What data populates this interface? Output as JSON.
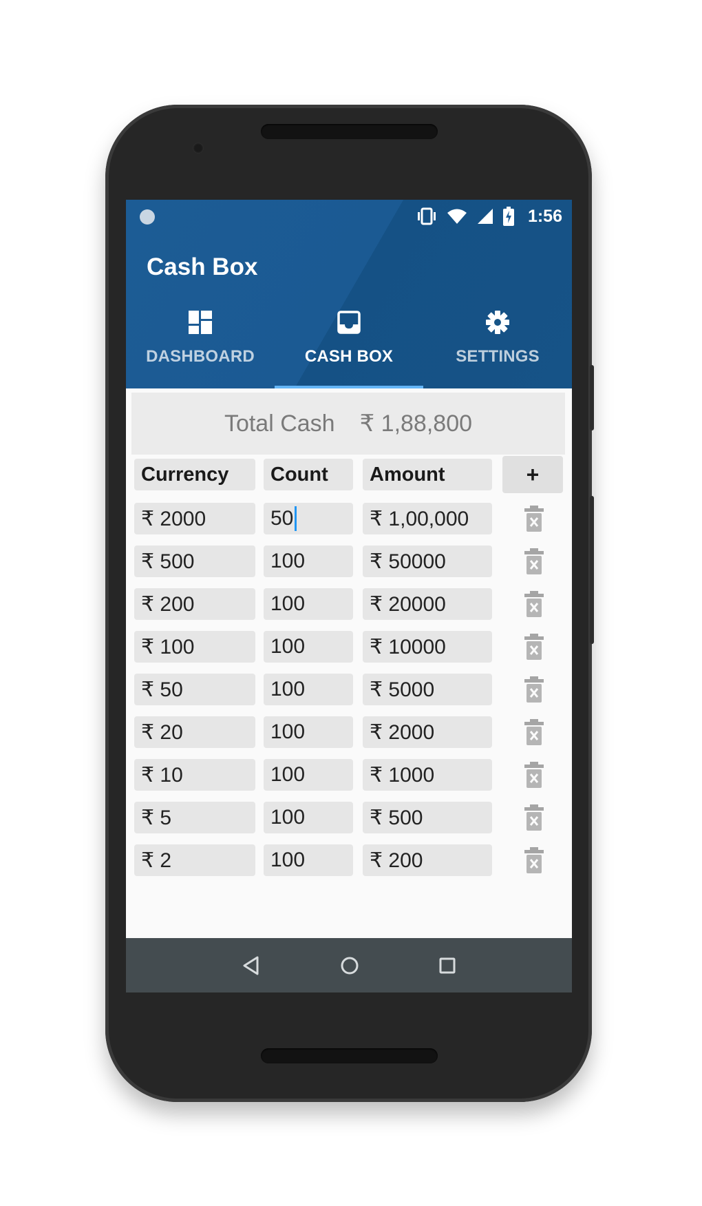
{
  "status_bar": {
    "time": "1:56"
  },
  "app": {
    "title": "Cash Box"
  },
  "tabs": [
    {
      "label": "DASHBOARD",
      "icon": "dashboard-icon",
      "active": false
    },
    {
      "label": "CASH BOX",
      "icon": "inbox-icon",
      "active": true
    },
    {
      "label": "SETTINGS",
      "icon": "gear-icon",
      "active": false
    }
  ],
  "total": {
    "label": "Total Cash",
    "value": "₹ 1,88,800"
  },
  "table": {
    "headers": {
      "currency": "Currency",
      "count": "Count",
      "amount": "Amount",
      "add": "+"
    },
    "rows": [
      {
        "currency": "₹ 2000",
        "count": "50",
        "amount": "₹ 1,00,000"
      },
      {
        "currency": "₹ 500",
        "count": "100",
        "amount": "₹ 50000"
      },
      {
        "currency": "₹ 200",
        "count": "100",
        "amount": "₹ 20000"
      },
      {
        "currency": "₹ 100",
        "count": "100",
        "amount": "₹ 10000"
      },
      {
        "currency": "₹ 50",
        "count": "100",
        "amount": "₹ 5000"
      },
      {
        "currency": "₹ 20",
        "count": "100",
        "amount": "₹ 2000"
      },
      {
        "currency": "₹ 10",
        "count": "100",
        "amount": "₹ 1000"
      },
      {
        "currency": "₹ 5",
        "count": "100",
        "amount": "₹ 500"
      },
      {
        "currency": "₹ 2",
        "count": "100",
        "amount": "₹ 200"
      }
    ]
  },
  "colors": {
    "primary": "#1b5a93",
    "accent": "#64b5f6",
    "navbar": "#444c50"
  }
}
